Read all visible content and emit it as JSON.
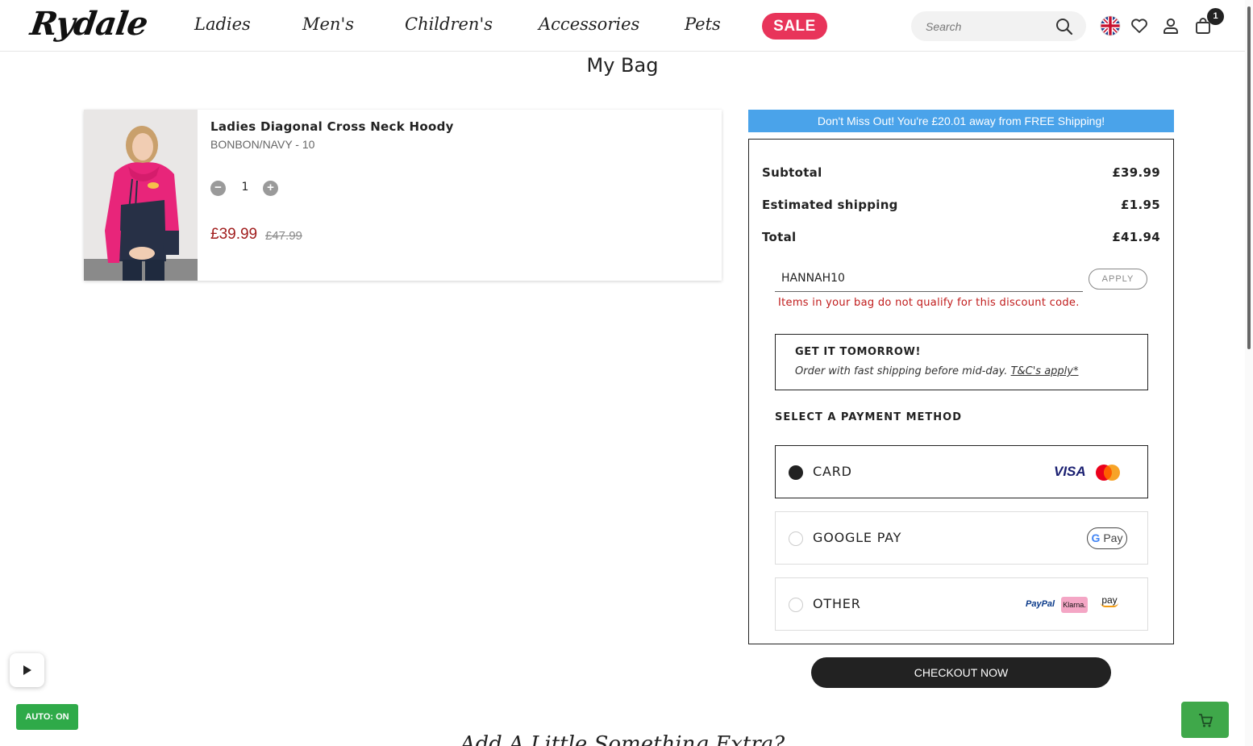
{
  "brand": {
    "logo_text": "Rydale"
  },
  "nav": {
    "items": [
      "Ladies",
      "Men's",
      "Children's",
      "Accessories",
      "Pets"
    ],
    "sale_label": "SALE"
  },
  "search": {
    "placeholder": "Search"
  },
  "header_icons": [
    "uk-flag-icon",
    "heart-icon",
    "user-icon",
    "shopping-bag-icon"
  ],
  "bag": {
    "count": "1"
  },
  "page": {
    "title": "My Bag"
  },
  "cart_item": {
    "name": "Ladies Diagonal Cross Neck Hoody",
    "variant": "BONBON/NAVY - 10",
    "quantity": "1",
    "price_now": "£39.99",
    "price_was": "£47.99",
    "minus_label": "−",
    "plus_label": "+"
  },
  "shipping_banner": "Don't Miss Out! You're £20.01 away from FREE Shipping!",
  "summary": {
    "subtotal_label": "Subtotal",
    "subtotal_value": "£39.99",
    "shipping_label": "Estimated shipping",
    "shipping_value": "£1.95",
    "total_label": "Total",
    "total_value": "£41.94"
  },
  "promo": {
    "code": "HANNAH10",
    "apply_label": "APPLY",
    "error": "Items in your bag do not qualify for this discount code."
  },
  "delivery": {
    "title": "GET IT TOMORROW!",
    "text": "Order with fast shipping before mid-day.",
    "link": "T&C's apply*"
  },
  "payment": {
    "heading": "SELECT A PAYMENT METHOD",
    "options": [
      {
        "label": "CARD",
        "selected": true
      },
      {
        "label": "GOOGLE PAY",
        "selected": false
      },
      {
        "label": "OTHER",
        "selected": false
      }
    ],
    "logos": {
      "visa": "VISA",
      "gpay": "Pay",
      "paypal": "PayPal",
      "klarna": "Klarna.",
      "amazon": "pay"
    }
  },
  "checkout_label": "CHECKOUT NOW",
  "more_heading": "Add A Little Something Extra?",
  "widgets": {
    "auto_label": "AUTO: ON"
  },
  "colors": {
    "sale": "#e8345a",
    "banner": "#4aa3ea",
    "price": "#a01c1c",
    "error": "#c01a1a",
    "checkout": "#222222",
    "auto": "#2faa49"
  }
}
